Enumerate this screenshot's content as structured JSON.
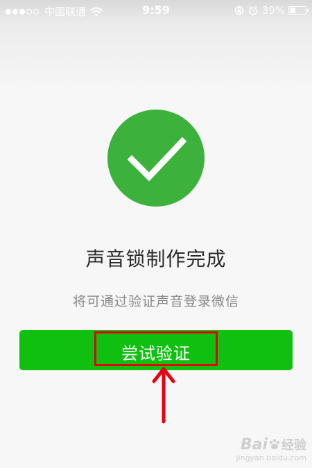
{
  "status_bar": {
    "signal_filled": 3,
    "signal_total": 5,
    "carrier": "中国联通",
    "time": "9:59",
    "battery_percent_text": "39%",
    "battery_level": 0.39
  },
  "main": {
    "success_icon": "checkmark-icon",
    "title": "声音锁制作完成",
    "subtitle": "将可通过验证声音登录微信",
    "try_button_label": "尝试验证"
  },
  "annotation": {
    "box_color": "#e60012",
    "arrow_color": "#e60012"
  },
  "watermark": {
    "logo_text": "Bai",
    "logo_suffix": "经验",
    "url": "jingyan.baidu.com"
  },
  "colors": {
    "success_green": "#3cb23c",
    "button_green": "#10c010"
  }
}
